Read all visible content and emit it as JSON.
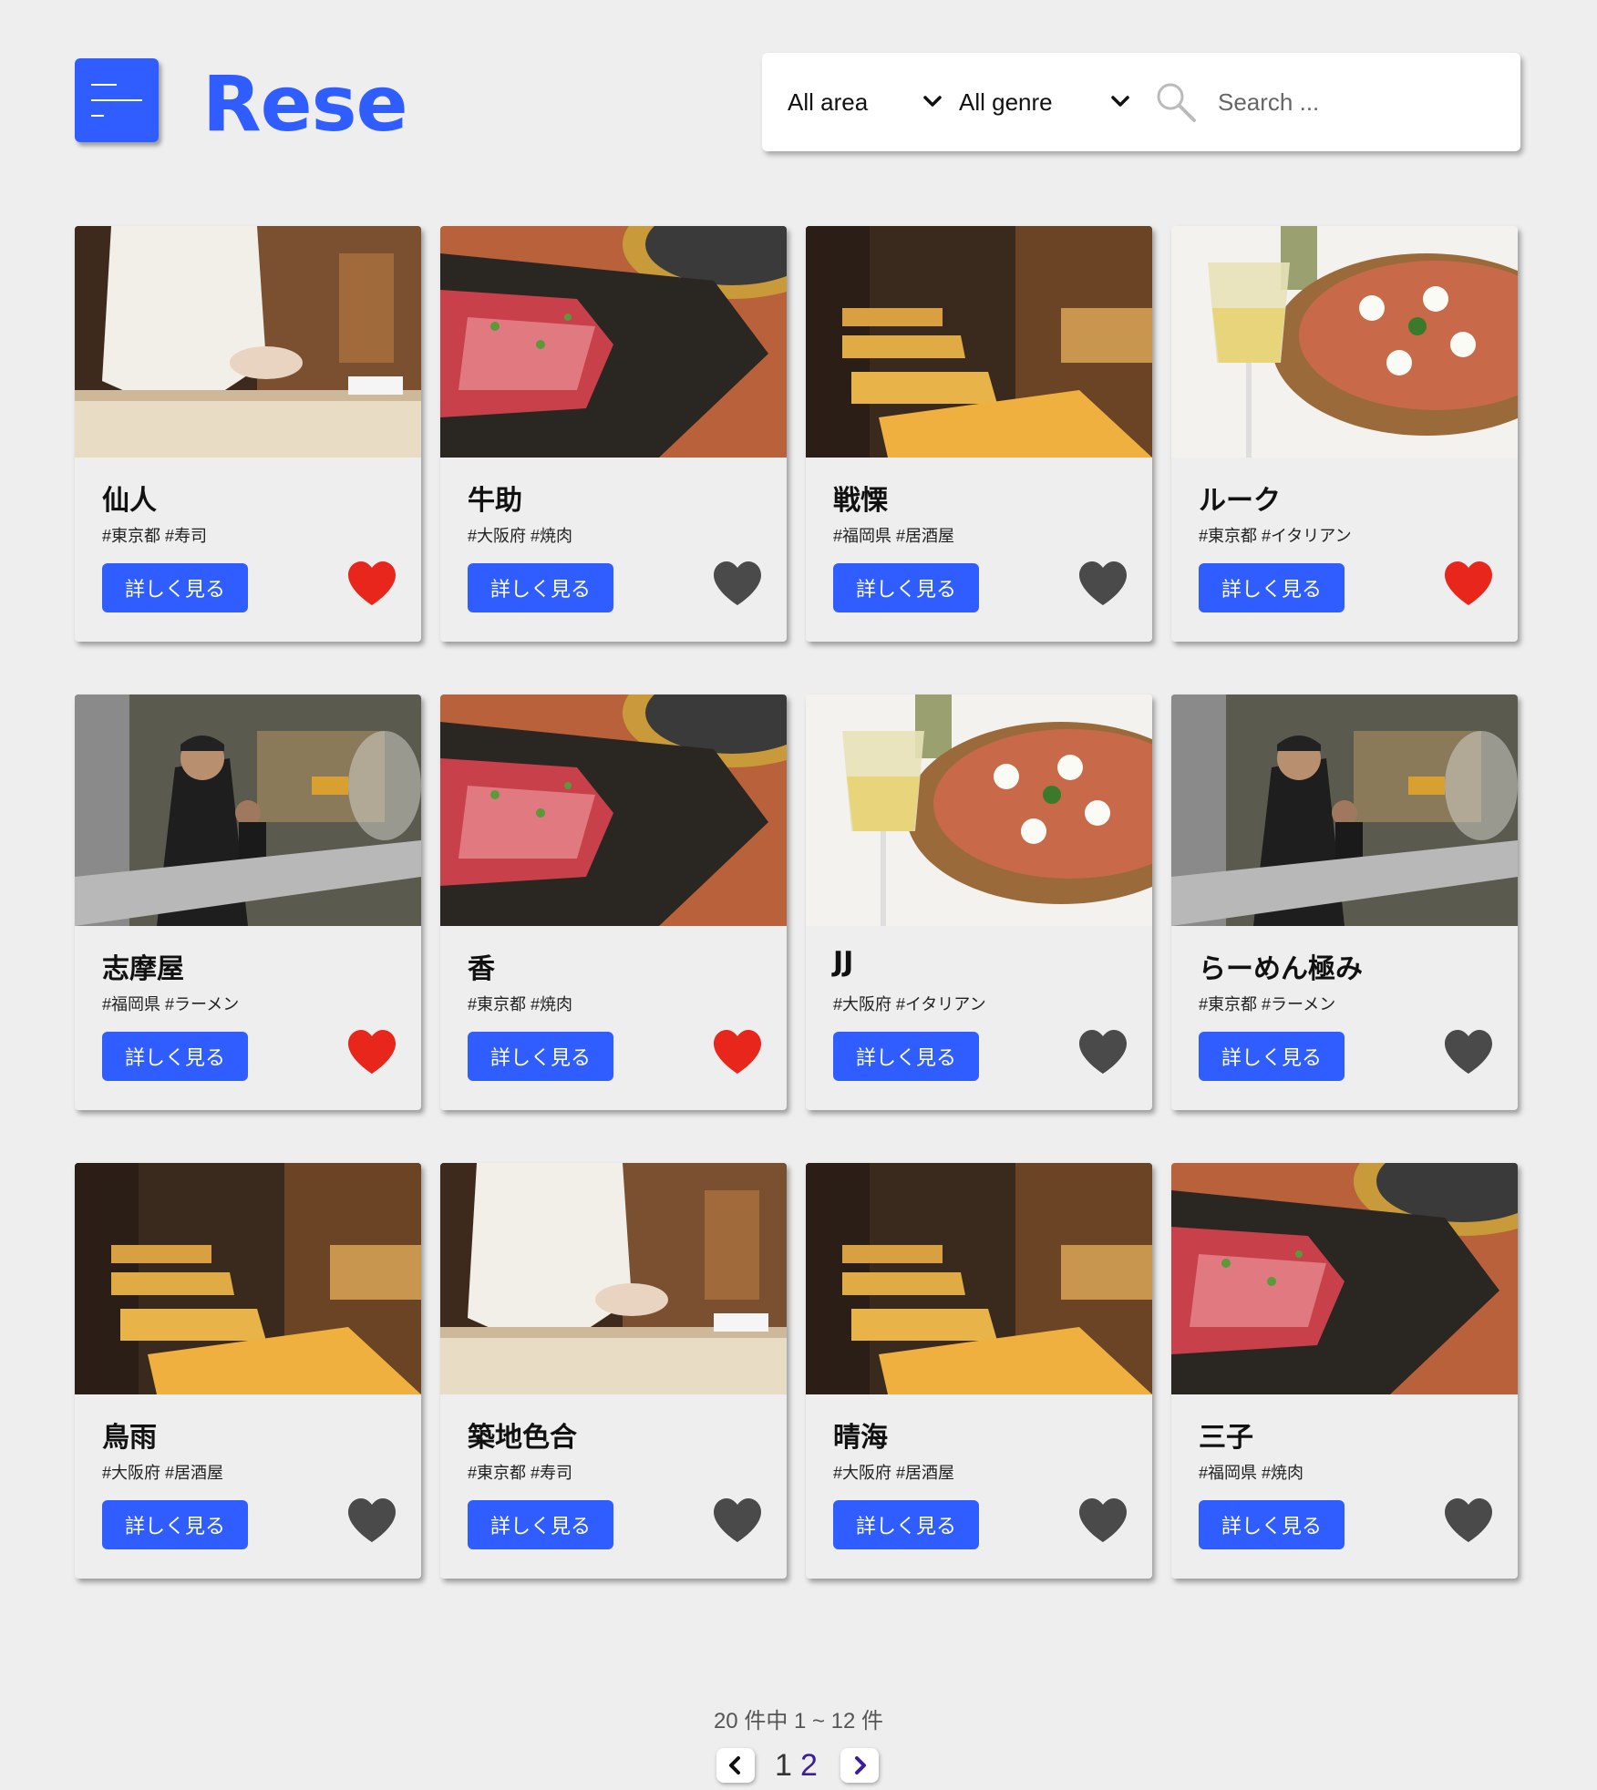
{
  "header": {
    "logo": "Rese",
    "area_select": "All area",
    "genre_select": "All genre",
    "search_placeholder": "Search ..."
  },
  "colors": {
    "accent": "#305dff",
    "favorite_on": "#e8261c",
    "favorite_off": "#4a4a4a",
    "background": "#eeeeee"
  },
  "detail_label": "詳しく見る",
  "shops": [
    {
      "name": "仙人",
      "tags": "#東京都 #寿司",
      "image": "sushi-chef",
      "favorite": true
    },
    {
      "name": "牛助",
      "tags": "#大阪府 #焼肉",
      "image": "yakiniku-beef",
      "favorite": false
    },
    {
      "name": "戦慄",
      "tags": "#福岡県 #居酒屋",
      "image": "izakaya-tables",
      "favorite": false
    },
    {
      "name": "ルーク",
      "tags": "#東京都 #イタリアン",
      "image": "pizza-wine",
      "favorite": true
    },
    {
      "name": "志摩屋",
      "tags": "#福岡県 #ラーメン",
      "image": "ramen-kitchen",
      "favorite": true
    },
    {
      "name": "香",
      "tags": "#東京都 #焼肉",
      "image": "yakiniku-beef",
      "favorite": true
    },
    {
      "name": "JJ",
      "tags": "#大阪府 #イタリアン",
      "image": "pizza-wine",
      "favorite": false
    },
    {
      "name": "らーめん極み",
      "tags": "#東京都 #ラーメン",
      "image": "ramen-kitchen",
      "favorite": false
    },
    {
      "name": "鳥雨",
      "tags": "#大阪府 #居酒屋",
      "image": "izakaya-tables",
      "favorite": false
    },
    {
      "name": "築地色合",
      "tags": "#東京都 #寿司",
      "image": "sushi-chef",
      "favorite": false
    },
    {
      "name": "晴海",
      "tags": "#大阪府 #居酒屋",
      "image": "izakaya-tables",
      "favorite": false
    },
    {
      "name": "三子",
      "tags": "#福岡県 #焼肉",
      "image": "yakiniku-beef",
      "favorite": false
    }
  ],
  "pagination": {
    "summary": "20 件中 1 ~ 12 件",
    "pages": [
      "1",
      "2"
    ]
  }
}
